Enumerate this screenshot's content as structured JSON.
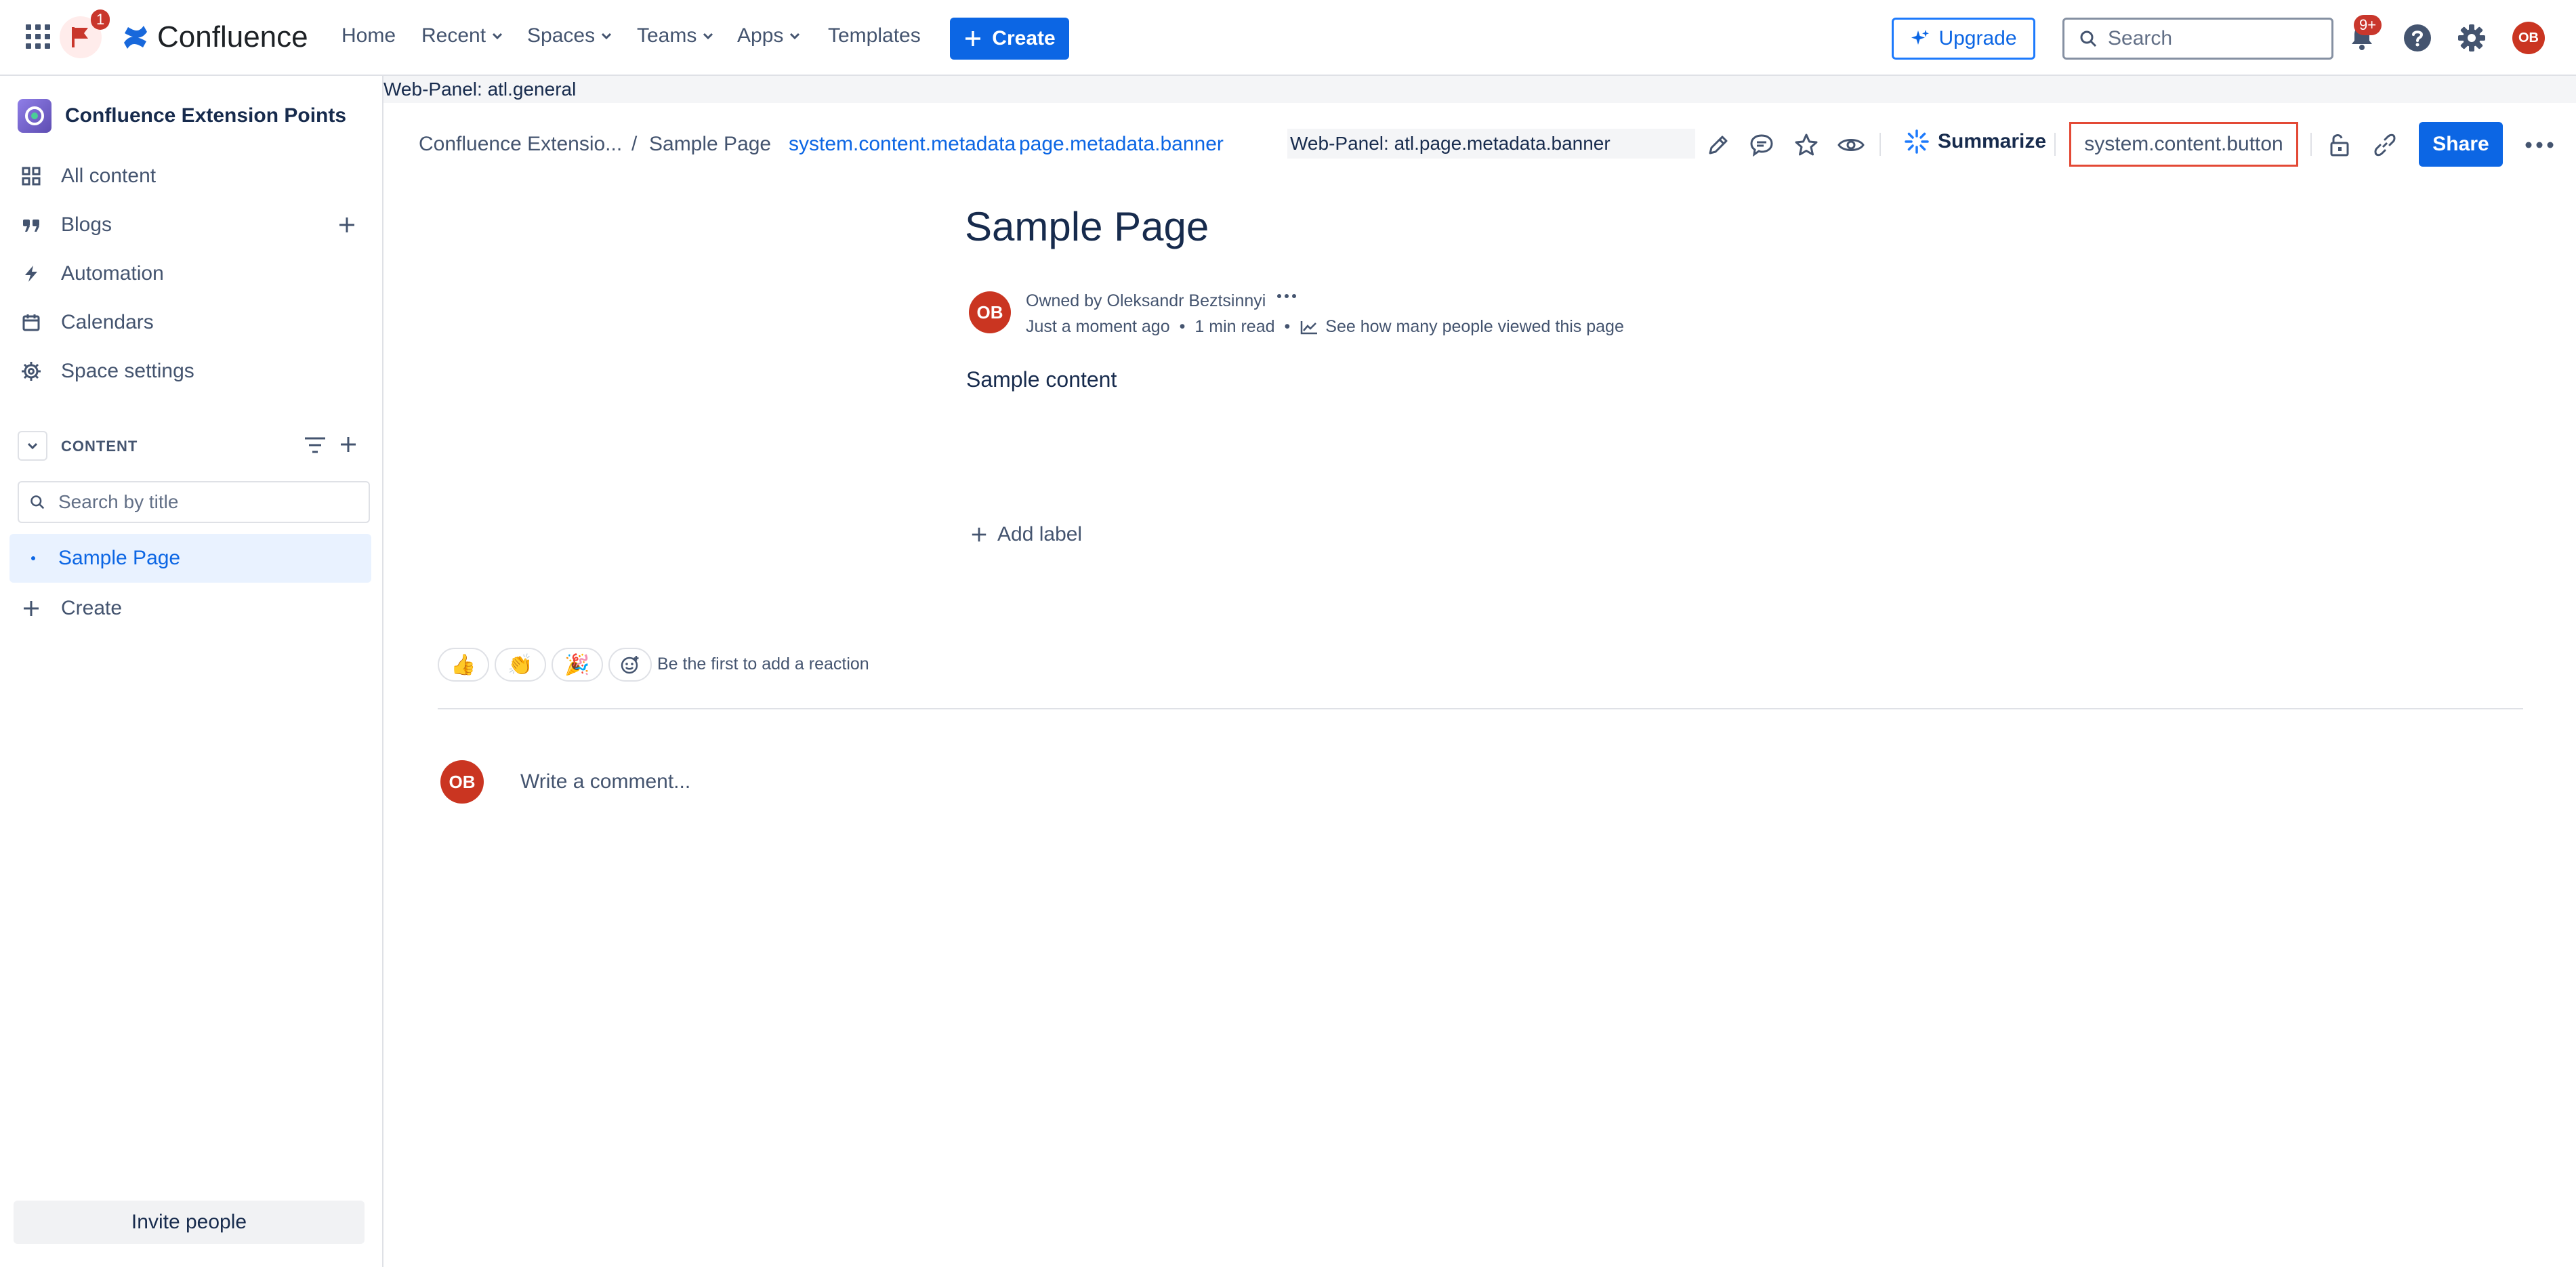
{
  "topnav": {
    "brand": "Confluence",
    "notification_count": "1",
    "links": [
      "Home",
      "Recent",
      "Spaces",
      "Teams",
      "Apps",
      "Templates"
    ],
    "create_label": "Create",
    "upgrade_label": "Upgrade",
    "search_placeholder": "Search",
    "updates_badge": "9+",
    "user_initials": "OB"
  },
  "sidebar": {
    "space_name": "Confluence Extension Points",
    "items": [
      {
        "label": "All content",
        "icon": "grid-icon"
      },
      {
        "label": "Blogs",
        "icon": "quote-icon"
      },
      {
        "label": "Automation",
        "icon": "lightning-icon"
      },
      {
        "label": "Calendars",
        "icon": "calendar-icon"
      },
      {
        "label": "Space settings",
        "icon": "gear-icon"
      }
    ],
    "content_heading": "CONTENT",
    "search_placeholder": "Search by title",
    "tree": [
      {
        "label": "Sample Page",
        "selected": true
      }
    ],
    "create_label": "Create",
    "invite_label": "Invite people"
  },
  "webpanel_general": "Web-Panel: atl.general",
  "toolbar": {
    "breadcrumb": [
      "Confluence Extensio...",
      "Sample Page"
    ],
    "metadata_links": [
      "system.content.metadata",
      "page.metadata.banner"
    ],
    "webpanel_banner": "Web-Panel: atl.page.metadata.banner",
    "summarize_label": "Summarize",
    "content_button": "system.content.button",
    "share_label": "Share"
  },
  "page": {
    "title": "Sample Page",
    "owner_initials": "OB",
    "owned_by": "Owned by Oleksandr Beztsinnyi",
    "updated": "Just a moment ago",
    "read_time": "1 min read",
    "views_link": "See how many people viewed this page",
    "body": "Sample content",
    "add_label": "Add label",
    "reactions": [
      "👍",
      "👏",
      "🎉"
    ],
    "reaction_prompt": "Be the first to add a reaction",
    "comment_initials": "OB",
    "comment_placeholder": "Write a comment..."
  },
  "colors": {
    "accent": "#0C66E4",
    "highlight_border": "#E34935",
    "avatar": "#CA3521",
    "sidebar_selected": "#E9F2FF"
  }
}
